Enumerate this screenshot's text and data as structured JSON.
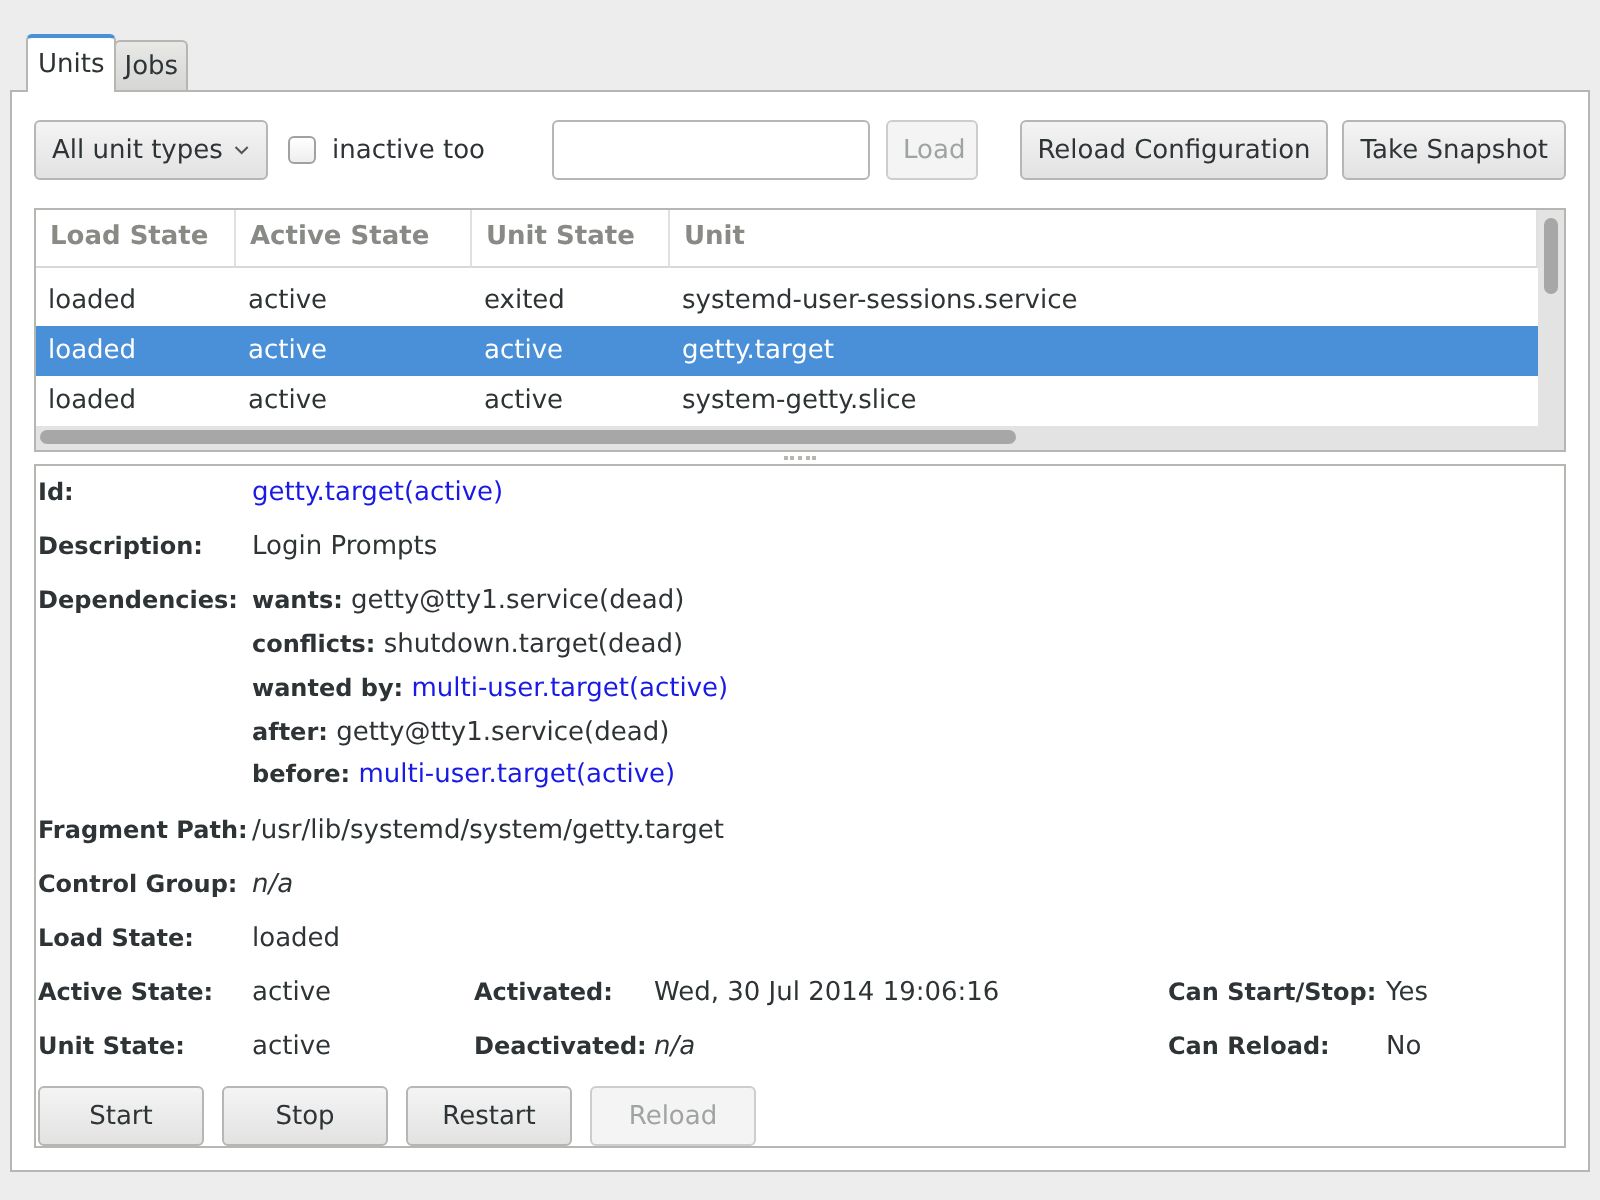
{
  "tabs": [
    {
      "label": "Units",
      "selected": true
    },
    {
      "label": "Jobs",
      "selected": false
    }
  ],
  "toolbar": {
    "unit_type": "All unit types",
    "inactive_too": {
      "label": "inactive too",
      "checked": false
    },
    "load": {
      "label": "Load",
      "disabled": true
    },
    "buttons": [
      {
        "label": "Reload Configuration",
        "disabled": false
      },
      {
        "label": "Take Snapshot",
        "disabled": false
      }
    ]
  },
  "table": {
    "columns": [
      "Load State",
      "Active State",
      "Unit State",
      "Unit"
    ],
    "rows": [
      {
        "cells": [
          "loaded",
          "active",
          "exited",
          "systemd-user-sessions.service"
        ],
        "selected": false
      },
      {
        "cells": [
          "loaded",
          "active",
          "active",
          "getty.target"
        ],
        "selected": true
      },
      {
        "cells": [
          "loaded",
          "active",
          "active",
          "system-getty.slice"
        ],
        "selected": false
      }
    ]
  },
  "details": {
    "fields": [
      {
        "kind": "value",
        "label": "Id:",
        "value": "getty.target(active)",
        "link": true,
        "italic": false
      },
      {
        "kind": "value",
        "label": "Description:",
        "value": "Login Prompts",
        "link": false,
        "italic": false
      },
      {
        "kind": "dependencies",
        "label": "Dependencies:",
        "items": [
          {
            "relation": "wants:",
            "target": "getty@tty1.service(dead)",
            "link": false
          },
          {
            "relation": "conflicts:",
            "target": "shutdown.target(dead)",
            "link": false
          },
          {
            "relation": "wanted by:",
            "target": "multi-user.target(active)",
            "link": true
          },
          {
            "relation": "after:",
            "target": "getty@tty1.service(dead)",
            "link": false
          },
          {
            "relation": "before:",
            "target": "multi-user.target(active)",
            "link": true
          }
        ]
      },
      {
        "kind": "value",
        "label": "Fragment Path:",
        "value": "/usr/lib/systemd/system/getty.target",
        "link": false,
        "italic": false
      },
      {
        "kind": "value",
        "label": "Control Group:",
        "value": "n/a",
        "link": false,
        "italic": true
      },
      {
        "kind": "value",
        "label": "Load State:",
        "value": "loaded",
        "link": false,
        "italic": false
      }
    ],
    "state_rows": [
      [
        {
          "label": "Active State:",
          "value": "active",
          "italic": false
        },
        {
          "label": "Activated:",
          "value": "Wed, 30 Jul 2014 19:06:16",
          "italic": false
        },
        {
          "label": "Can Start/Stop:",
          "value": "Yes",
          "italic": false
        }
      ],
      [
        {
          "label": "Unit State:",
          "value": "active",
          "italic": false
        },
        {
          "label": "Deactivated:",
          "value": "n/a",
          "italic": true
        },
        {
          "label": "Can Reload:",
          "value": "No",
          "italic": false
        }
      ]
    ],
    "buttons": [
      {
        "label": "Start",
        "disabled": false
      },
      {
        "label": "Stop",
        "disabled": false
      },
      {
        "label": "Restart",
        "disabled": false
      },
      {
        "label": "Reload",
        "disabled": true
      }
    ]
  }
}
